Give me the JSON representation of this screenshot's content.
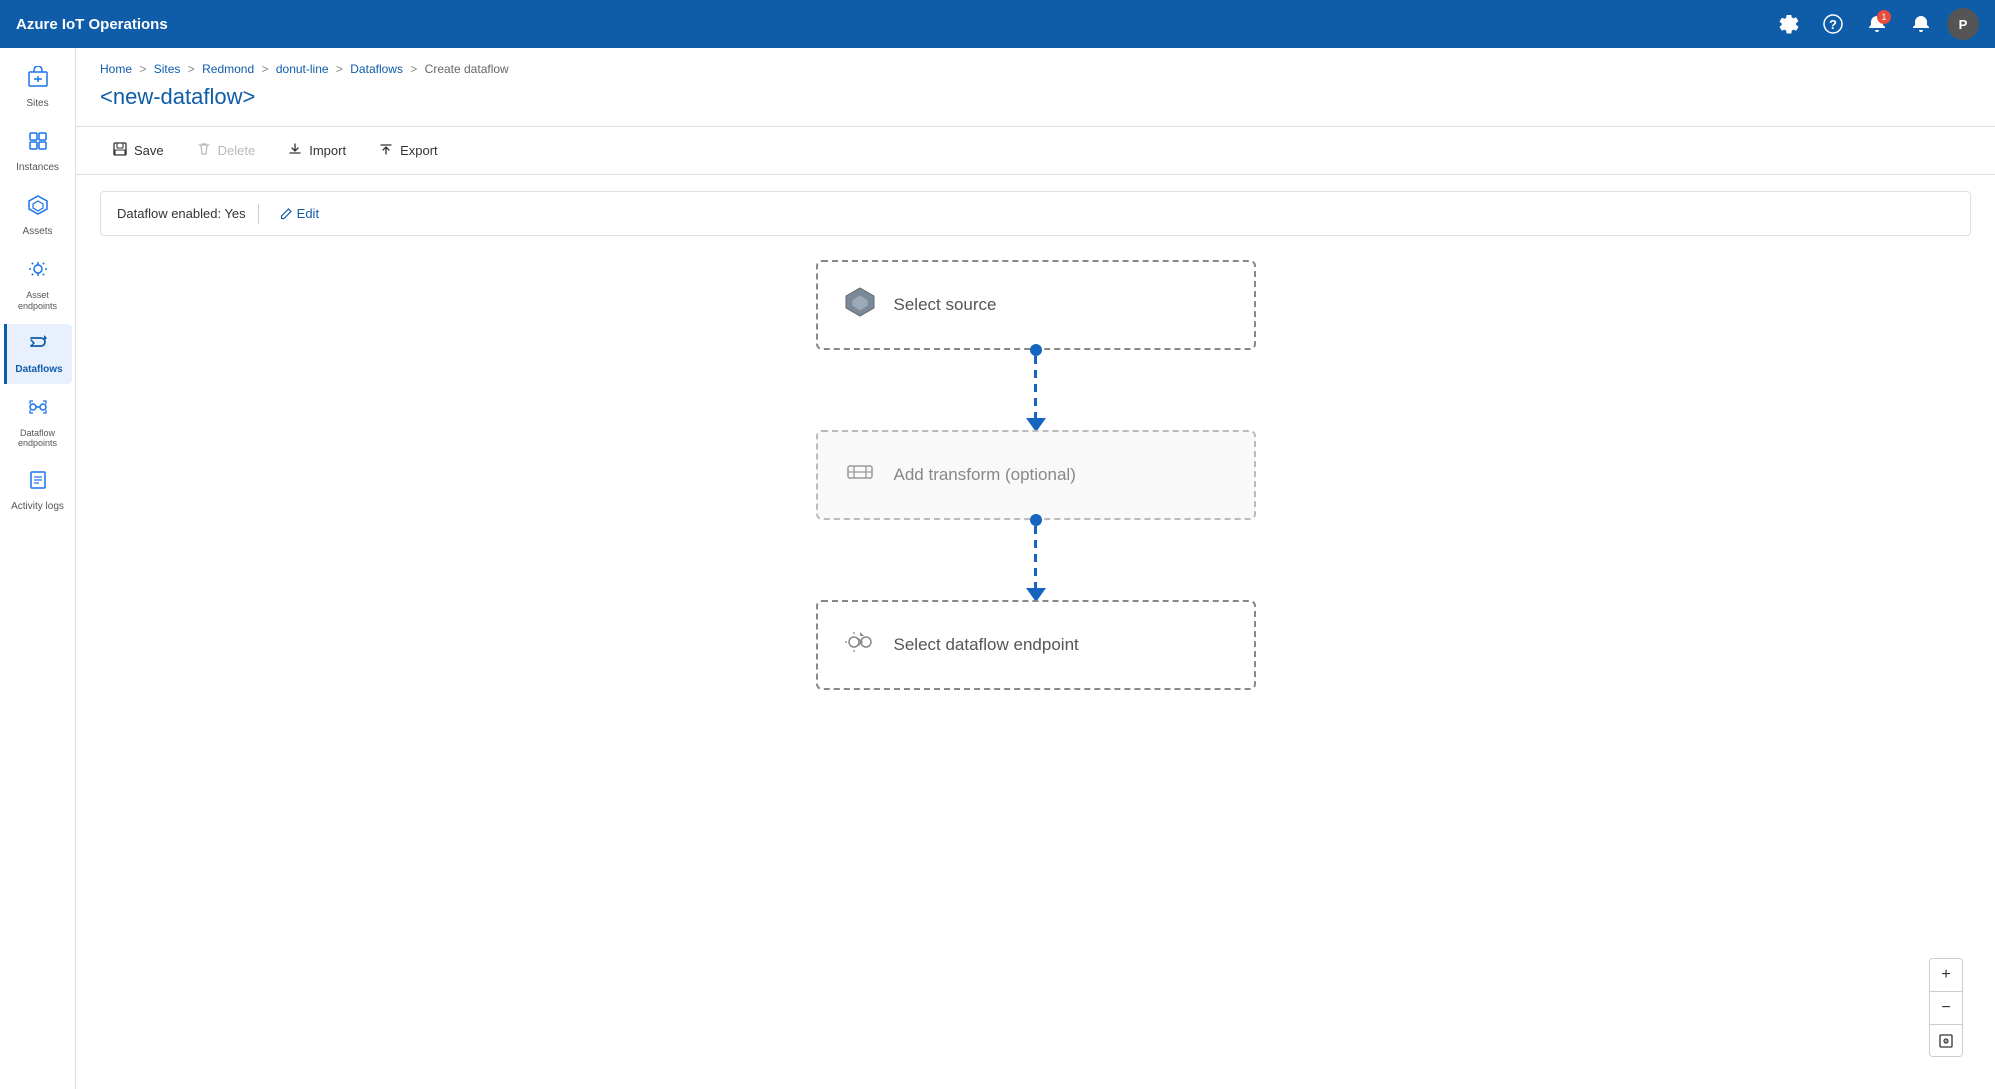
{
  "app": {
    "title": "Azure IoT Operations"
  },
  "topnav": {
    "title": "Azure IoT Operations",
    "icons": {
      "settings": "⚙",
      "help": "?",
      "notifications": "🔔",
      "alerts": "🔔",
      "notif_count": "1",
      "avatar_label": "P"
    }
  },
  "sidebar": {
    "items": [
      {
        "id": "sites",
        "label": "Sites",
        "icon": "🏢",
        "active": false
      },
      {
        "id": "instances",
        "label": "Instances",
        "icon": "⚡",
        "active": false
      },
      {
        "id": "assets",
        "label": "Assets",
        "icon": "📦",
        "active": false
      },
      {
        "id": "asset-endpoints",
        "label": "Asset endpoints",
        "icon": "🔗",
        "active": false
      },
      {
        "id": "dataflows",
        "label": "Dataflows",
        "icon": "↔",
        "active": true
      },
      {
        "id": "dataflow-endpoints",
        "label": "Dataflow endpoints",
        "icon": "⇆",
        "active": false
      },
      {
        "id": "activity-logs",
        "label": "Activity logs",
        "icon": "📋",
        "active": false
      }
    ]
  },
  "breadcrumb": {
    "items": [
      "Home",
      "Sites",
      "Redmond",
      "donut-line",
      "Dataflows",
      "Create dataflow"
    ],
    "separators": [
      ">",
      ">",
      ">",
      ">",
      ">"
    ]
  },
  "page": {
    "title": "<new-dataflow>"
  },
  "toolbar": {
    "save_label": "Save",
    "delete_label": "Delete",
    "import_label": "Import",
    "export_label": "Export"
  },
  "dataflow_status": {
    "text": "Dataflow enabled: Yes",
    "edit_label": "Edit"
  },
  "flow": {
    "nodes": [
      {
        "id": "source",
        "label": "Select source",
        "icon": "📦",
        "type": "primary"
      },
      {
        "id": "transform",
        "label": "Add transform (optional)",
        "icon": "⊞",
        "type": "secondary"
      },
      {
        "id": "endpoint",
        "label": "Select dataflow endpoint",
        "icon": "🔗",
        "type": "primary"
      }
    ]
  },
  "zoom": {
    "plus_label": "+",
    "minus_label": "−",
    "fit_label": "⊡"
  }
}
